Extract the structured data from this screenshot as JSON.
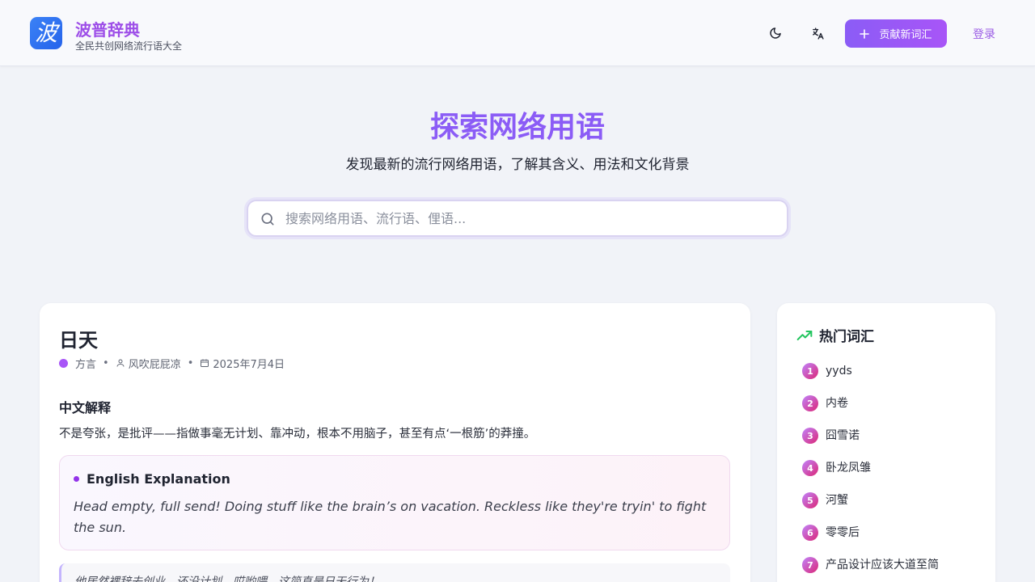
{
  "header": {
    "logo_char": "波",
    "title": "波普辞典",
    "subtitle": "全民共创网络流行语大全",
    "contribute_label": "贡献新词汇",
    "login_label": "登录"
  },
  "hero": {
    "title": "探索网络用语",
    "subtitle": "发现最新的流行网络用语，了解其含义、用法和文化背景",
    "search_placeholder": "搜索网络用语、流行语、俚语..."
  },
  "entry": {
    "word": "日天",
    "category": "方言",
    "author": "风吹屁屁凉",
    "date": "2025年7月4日",
    "cn_heading": "中文解释",
    "cn_explanation": "不是夸张，是批评——指做事毫无计划、靠冲动，根本不用脑子，甚至有点‘一根筋’的莽撞。",
    "en_heading": "English Explanation",
    "en_explanation": "Head empty, full send! Doing stuff like the brain’s on vacation. Reckless like they're tryin' to fight the sun.",
    "example": "他居然裸辞去创业，还没计划，哎哟喂，这简直是日天行为！"
  },
  "sidebar": {
    "heading": "热门词汇",
    "items": [
      {
        "rank": "1",
        "label": "yyds"
      },
      {
        "rank": "2",
        "label": "内卷"
      },
      {
        "rank": "3",
        "label": "囧雪诺"
      },
      {
        "rank": "4",
        "label": "卧龙凤雏"
      },
      {
        "rank": "5",
        "label": "河蟹"
      },
      {
        "rank": "6",
        "label": "零零后"
      },
      {
        "rank": "7",
        "label": "产品设计应该大道至简"
      }
    ]
  },
  "colors": {
    "accent": "#8b5cf6",
    "trend_icon": "#22c55e"
  }
}
